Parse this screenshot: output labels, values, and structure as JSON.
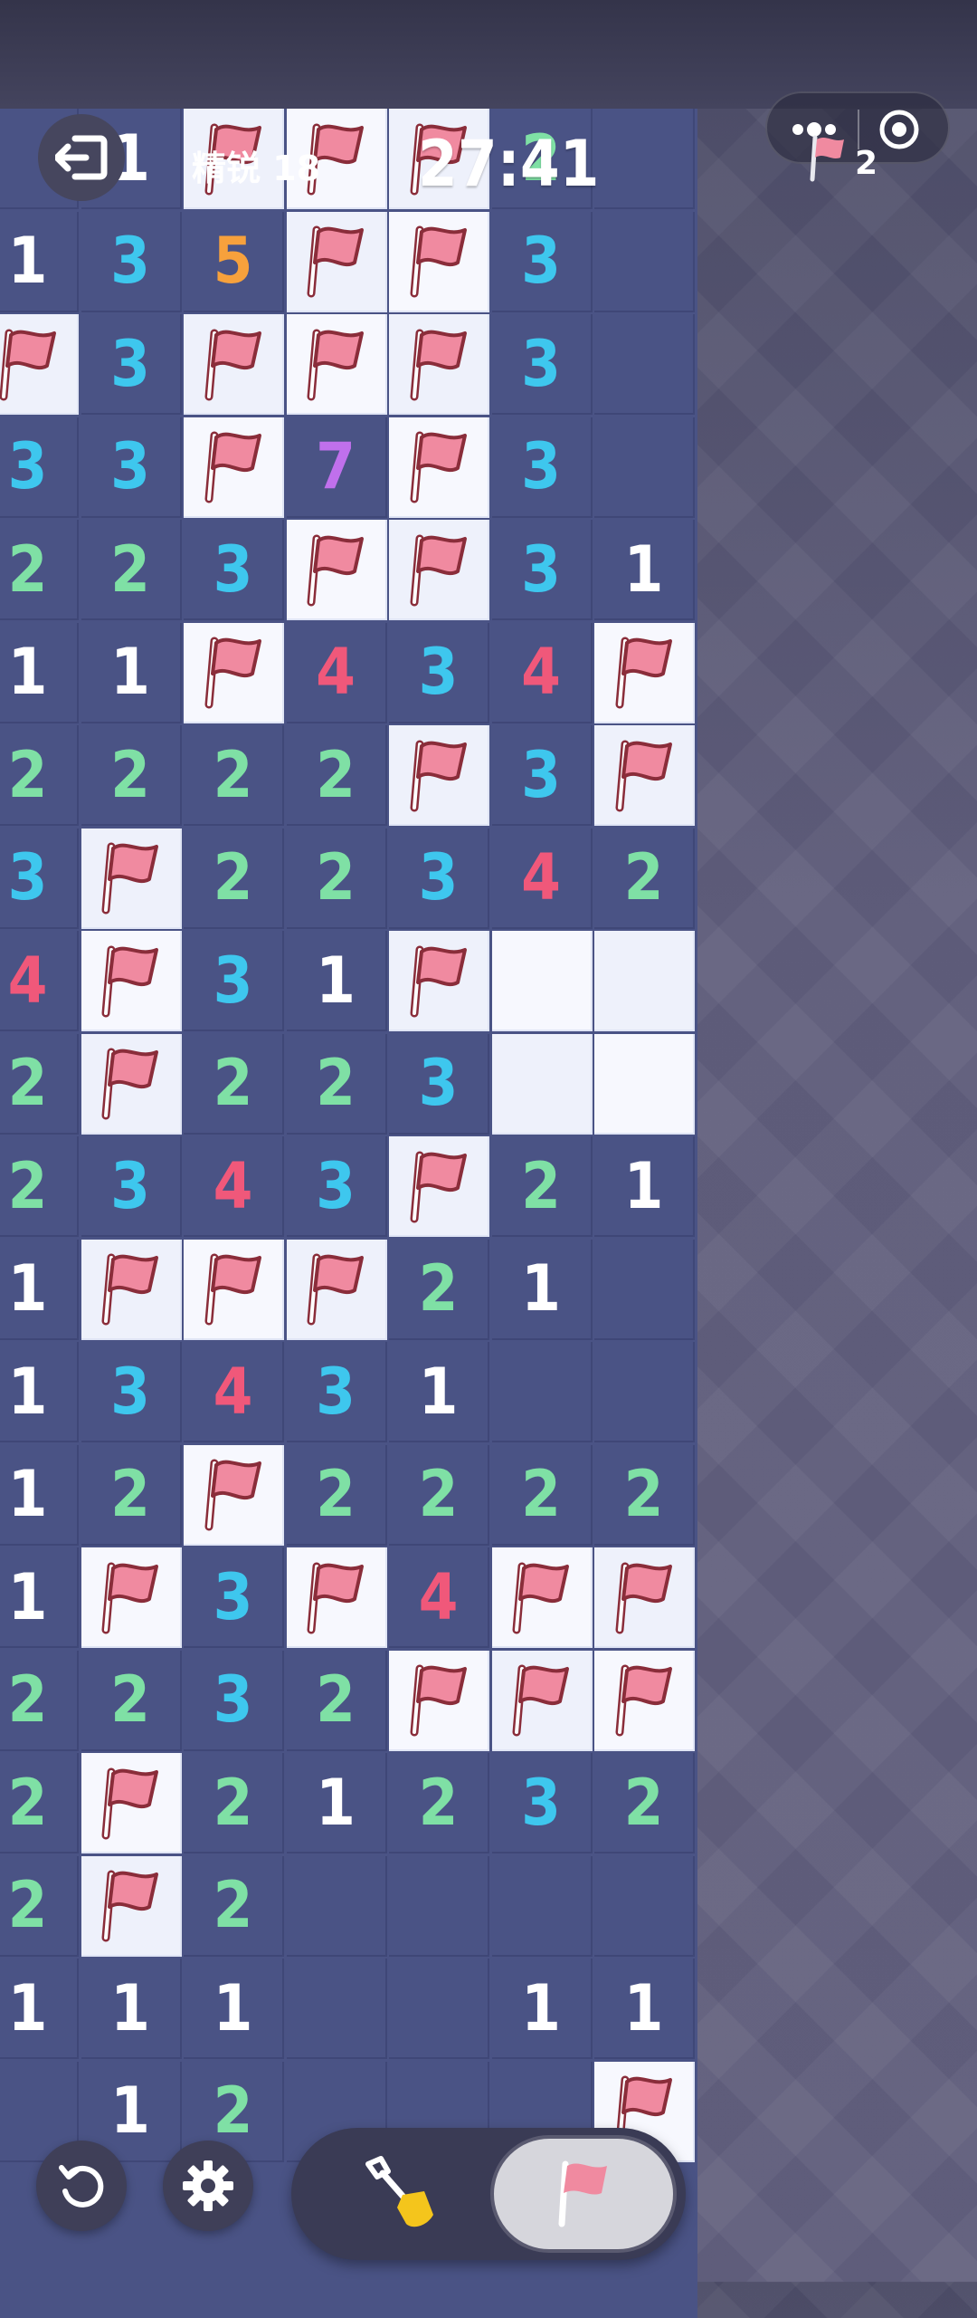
{
  "hud": {
    "exit_icon": "exit-icon",
    "difficulty": "精锐 18",
    "timer": "27:41",
    "mines_remaining": "2",
    "more_icon": "more-icon",
    "close_icon": "target-icon"
  },
  "controls": {
    "restart_icon": "restart-icon",
    "settings_icon": "gear-icon",
    "dig_icon": "shovel-icon",
    "flag_icon": "flag-icon",
    "active_mode": "flag"
  },
  "colors": {
    "board": "#4a5385",
    "hidden_cell": "#eef1fb",
    "flag": "#f08aa0",
    "num1": "#ffffff",
    "num2": "#7fe0a5",
    "num3": "#3ec7ee",
    "num4": "#f0587a",
    "num5": "#f7a13c",
    "num7": "#c070ec"
  },
  "board": {
    "cols": 7,
    "legend": "F = flag, H = hidden, E = empty revealed, digits = adjacent mine count",
    "rows": [
      [
        "E",
        "1",
        "F",
        "F",
        "F",
        "2",
        "E"
      ],
      [
        "1",
        "3",
        "5",
        "F",
        "F",
        "3",
        "E"
      ],
      [
        "F",
        "3",
        "F",
        "F",
        "F",
        "3",
        "E"
      ],
      [
        "3",
        "3",
        "F",
        "7",
        "F",
        "3",
        "E"
      ],
      [
        "2",
        "2",
        "3",
        "F",
        "F",
        "3",
        "1"
      ],
      [
        "1",
        "1",
        "F",
        "4",
        "3",
        "4",
        "F"
      ],
      [
        "2",
        "2",
        "2",
        "2",
        "F",
        "3",
        "F"
      ],
      [
        "3",
        "F",
        "2",
        "2",
        "3",
        "4",
        "2"
      ],
      [
        "4",
        "F",
        "3",
        "1",
        "F",
        "H",
        "H"
      ],
      [
        "2",
        "F",
        "2",
        "2",
        "3",
        "H",
        "H"
      ],
      [
        "2",
        "3",
        "4",
        "3",
        "F",
        "2",
        "1"
      ],
      [
        "1",
        "F",
        "F",
        "F",
        "2",
        "1",
        "E"
      ],
      [
        "1",
        "3",
        "4",
        "3",
        "1",
        "E",
        "E"
      ],
      [
        "1",
        "2",
        "F",
        "2",
        "2",
        "2",
        "2"
      ],
      [
        "1",
        "F",
        "3",
        "F",
        "4",
        "F",
        "F"
      ],
      [
        "2",
        "2",
        "3",
        "2",
        "F",
        "F",
        "F"
      ],
      [
        "2",
        "F",
        "2",
        "1",
        "2",
        "3",
        "2"
      ],
      [
        "2",
        "F",
        "2",
        "E",
        "E",
        "E",
        "E"
      ],
      [
        "1",
        "1",
        "1",
        "E",
        "E",
        "1",
        "1"
      ],
      [
        "E",
        "1",
        "2",
        "E",
        "E",
        "E",
        "F"
      ]
    ]
  }
}
